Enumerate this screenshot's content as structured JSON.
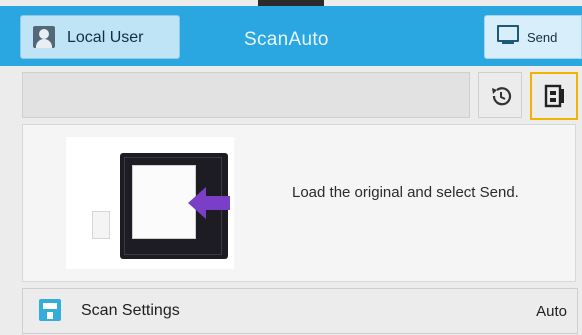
{
  "header": {
    "user_label": "Local User",
    "title": "ScanAuto",
    "send_label": "Send"
  },
  "icons": {
    "user": "user-icon",
    "send": "monitor-icon",
    "history": "history-icon",
    "jobs": "job-status-icon",
    "settings": "scanner-settings-icon"
  },
  "main": {
    "instruction": "Load the original and select Send."
  },
  "settings": {
    "label": "Scan Settings",
    "value": "Auto"
  },
  "colors": {
    "header": "#2aa6e0",
    "highlight_border": "#f0b400",
    "arrow": "#7a3fc6"
  }
}
